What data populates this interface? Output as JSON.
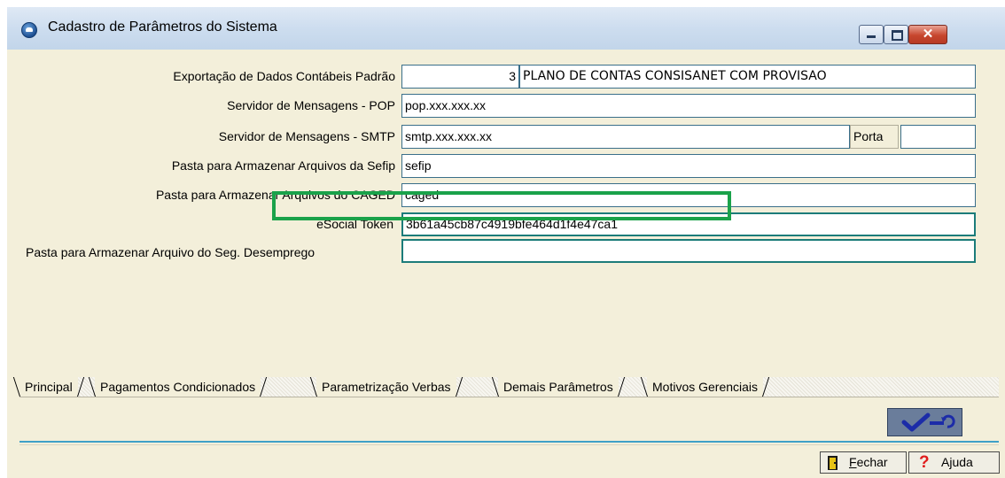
{
  "window": {
    "title": "Cadastro de Parâmetros do Sistema",
    "close_glyph": "✕"
  },
  "form": {
    "export_label": "Exportação de Dados Contábeis Padrão",
    "export_code": "3",
    "export_desc": "PLANO DE CONTAS CONSISANET COM PROVISAO",
    "pop_label": "Servidor de Mensagens - POP",
    "pop_value": "pop.xxx.xxx.xx",
    "smtp_label": "Servidor de Mensagens - SMTP",
    "smtp_value": "smtp.xxx.xxx.xx",
    "porta_label": "Porta",
    "porta_value": "",
    "sefip_label": "Pasta para Armazenar Arquivos da Sefip",
    "sefip_value": "sefip",
    "caged_label": "Pasta para Armazenar Arquivos do CAGED",
    "caged_value": "caged",
    "token_label": "eSocial Token",
    "token_value": "3b61a45cb87c4919bfe464d1f4e47ca1",
    "segdes_label": "Pasta para Armazenar Arquivo do Seg. Desemprego",
    "segdes_value": ""
  },
  "tabs": [
    {
      "label": "Principal"
    },
    {
      "label": "Pagamentos Condicionados"
    },
    {
      "label": "Parametrização Verbas"
    },
    {
      "label": "Demais Parâmetros"
    },
    {
      "label": "Motivos Gerenciais"
    }
  ],
  "buttons": {
    "fechar_label": "Fechar",
    "fechar_mnemonic": "F",
    "fechar_rest": "echar",
    "ajuda_label": "Ajuda"
  },
  "colors": {
    "client_bg": "#f3efda",
    "highlight": "#1aa24a",
    "field_border_teal": "#1c7c7a"
  },
  "icons": [
    "app-icon",
    "minimize-icon",
    "maximize-icon",
    "close-icon",
    "confirm-check-icon",
    "undo-arrow-icon",
    "door-exit-icon",
    "help-question-icon"
  ]
}
